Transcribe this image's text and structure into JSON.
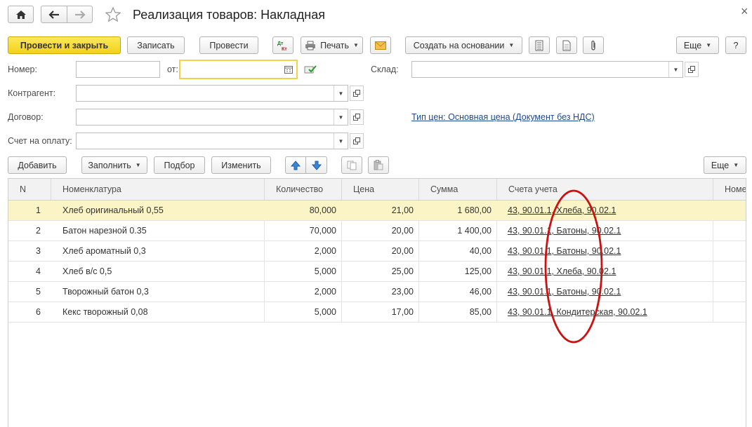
{
  "header": {
    "title": "Реализация товаров: Накладная",
    "home_icon": "home-icon",
    "back_icon": "arrow-left-icon",
    "forward_icon": "arrow-right-icon",
    "favorite_icon": "star-icon",
    "close_glyph": "×"
  },
  "toolbar": {
    "post_close_label": "Провести и закрыть",
    "save_label": "Записать",
    "post_label": "Провести",
    "dt_kt_label": "Дт Кт",
    "print_label": "Печать",
    "create_based_label": "Создать на основании",
    "more_label": "Еще",
    "help_label": "?"
  },
  "form": {
    "number_label": "Номер:",
    "number_value": "",
    "date_label": "от:",
    "date_value": "",
    "warehouse_label": "Склад:",
    "warehouse_value": "",
    "counterparty_label": "Контрагент:",
    "counterparty_value": "",
    "contract_label": "Договор:",
    "contract_value": "",
    "invoice_label": "Счет на оплату:",
    "invoice_value": "",
    "price_type_link": "Тип цен: Основная цена (Документ без НДС)"
  },
  "table_toolbar": {
    "add_label": "Добавить",
    "fill_label": "Заполнить",
    "select_label": "Подбор",
    "change_label": "Изменить",
    "more_label": "Еще"
  },
  "table": {
    "columns": [
      "N",
      "Номенклатура",
      "Количество",
      "Цена",
      "Сумма",
      "Счета учета",
      "Номе"
    ],
    "rows": [
      {
        "n": "1",
        "item": "Хлеб оригинальный 0,55",
        "qty": "80,000",
        "price": "21,00",
        "sum": "1 680,00",
        "accounts": "43, 90.01.1, Хлеба, 90.02.1"
      },
      {
        "n": "2",
        "item": "Батон нарезной 0.35",
        "qty": "70,000",
        "price": "20,00",
        "sum": "1 400,00",
        "accounts": "43, 90.01.1, Батоны, 90.02.1"
      },
      {
        "n": "3",
        "item": "Хлеб ароматный 0,3",
        "qty": "2,000",
        "price": "20,00",
        "sum": "40,00",
        "accounts": "43, 90.01.1, Батоны, 90.02.1"
      },
      {
        "n": "4",
        "item": "Хлеб в/с 0,5",
        "qty": "5,000",
        "price": "25,00",
        "sum": "125,00",
        "accounts": "43, 90.01.1, Хлеба, 90.02.1"
      },
      {
        "n": "5",
        "item": "Творожный батон 0,3",
        "qty": "2,000",
        "price": "23,00",
        "sum": "46,00",
        "accounts": "43, 90.01.1, Батоны, 90.02.1"
      },
      {
        "n": "6",
        "item": "Кекс творожный 0,08",
        "qty": "5,000",
        "price": "17,00",
        "sum": "85,00",
        "accounts": "43, 90.01.1, Кондитерская, 90.02.1"
      }
    ]
  },
  "colors": {
    "primary_button": "#f5d62a",
    "selected_row": "#fbf4c6",
    "link": "#1c4a8c",
    "annotation_circle": "#cc1111",
    "focused_field_border": "#f0d34a"
  }
}
